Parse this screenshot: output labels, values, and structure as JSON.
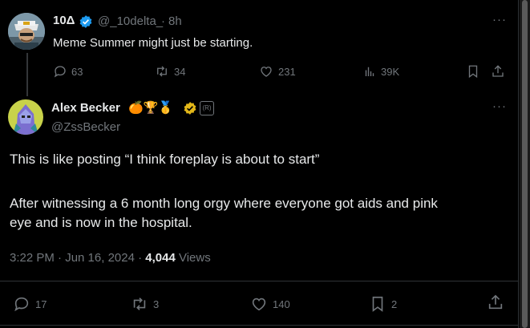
{
  "first_post": {
    "display_name": "10Δ",
    "handle": "@_10delta_",
    "separator": "·",
    "time": "8h",
    "text": "Meme Summer might just be starting.",
    "replies": "63",
    "reposts": "34",
    "likes": "231",
    "views": "39K",
    "more": "···"
  },
  "main_post": {
    "display_name": "Alex Becker",
    "handle": "@ZssBecker",
    "badge_emojis": "🍊🏆🥇",
    "label_badge": "(R)",
    "line1": "This is like posting “I think foreplay is about to start”",
    "line2": "After witnessing a 6 month long orgy where everyone got aids and pink",
    "line3": "eye and is now in the hospital.",
    "timestamp": "3:22 PM · Jun 16, 2024 · ",
    "views_count": "4,044",
    "views_label": " Views",
    "replies": "17",
    "reposts": "3",
    "likes": "140",
    "bookmarks": "2",
    "more": "···"
  },
  "colors": {
    "verified": "#1d9bf0",
    "gold_check": "#e2b719",
    "muted": "#71767b"
  }
}
